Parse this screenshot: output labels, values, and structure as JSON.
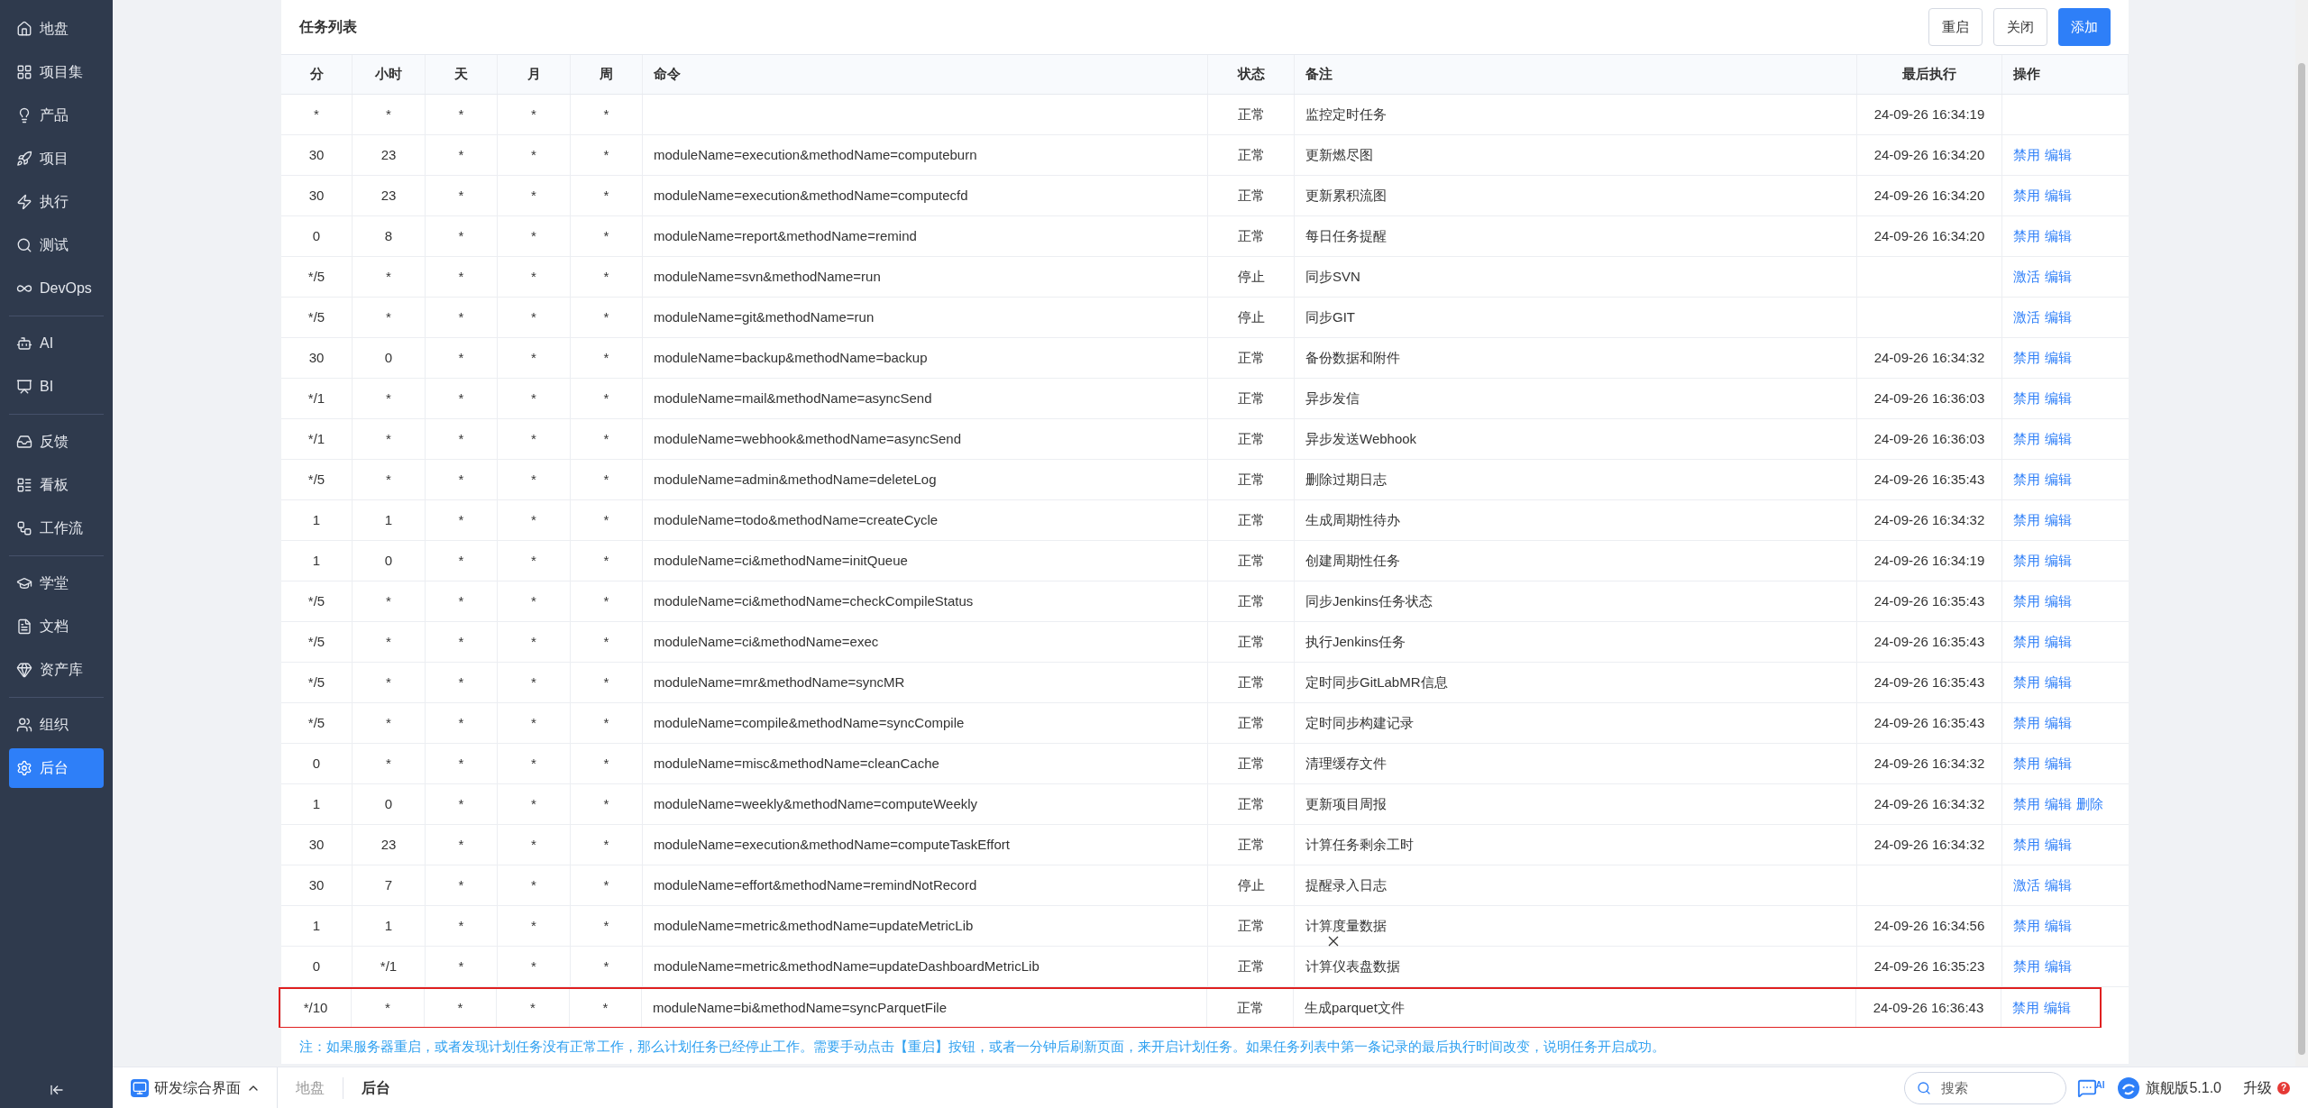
{
  "sidebar": {
    "groups": [
      [
        {
          "label": "地盘",
          "selected": false
        },
        {
          "label": "项目集",
          "selected": false
        },
        {
          "label": "产品",
          "selected": false
        },
        {
          "label": "项目",
          "selected": false
        },
        {
          "label": "执行",
          "selected": false
        },
        {
          "label": "测试",
          "selected": false
        },
        {
          "label": "DevOps",
          "selected": false
        }
      ],
      [
        {
          "label": "AI",
          "selected": false
        },
        {
          "label": "BI",
          "selected": false
        }
      ],
      [
        {
          "label": "反馈",
          "selected": false
        },
        {
          "label": "看板",
          "selected": false
        },
        {
          "label": "工作流",
          "selected": false
        }
      ],
      [
        {
          "label": "学堂",
          "selected": false
        },
        {
          "label": "文档",
          "selected": false
        },
        {
          "label": "资产库",
          "selected": false
        }
      ],
      [
        {
          "label": "组织",
          "selected": false
        },
        {
          "label": "后台",
          "selected": true
        }
      ]
    ]
  },
  "panel": {
    "title": "任务列表",
    "buttons": [
      {
        "label": "重启",
        "primary": false
      },
      {
        "label": "关闭",
        "primary": false
      },
      {
        "label": "添加",
        "primary": true
      }
    ]
  },
  "table": {
    "columns": [
      "分",
      "小时",
      "天",
      "月",
      "周",
      "命令",
      "状态",
      "备注",
      "最后执行",
      "操作"
    ],
    "rows": [
      {
        "cells": [
          "*",
          "*",
          "*",
          "*",
          "*",
          "",
          "正常",
          "监控定时任务",
          "24-09-26 16:34:19"
        ],
        "actions": [],
        "highlighted": false
      },
      {
        "cells": [
          "30",
          "23",
          "*",
          "*",
          "*",
          "moduleName=execution&methodName=computeburn",
          "正常",
          "更新燃尽图",
          "24-09-26 16:34:20"
        ],
        "actions": [
          "禁用",
          "编辑"
        ],
        "highlighted": false
      },
      {
        "cells": [
          "30",
          "23",
          "*",
          "*",
          "*",
          "moduleName=execution&methodName=computecfd",
          "正常",
          "更新累积流图",
          "24-09-26 16:34:20"
        ],
        "actions": [
          "禁用",
          "编辑"
        ],
        "highlighted": false
      },
      {
        "cells": [
          "0",
          "8",
          "*",
          "*",
          "*",
          "moduleName=report&methodName=remind",
          "正常",
          "每日任务提醒",
          "24-09-26 16:34:20"
        ],
        "actions": [
          "禁用",
          "编辑"
        ],
        "highlighted": false
      },
      {
        "cells": [
          "*/5",
          "*",
          "*",
          "*",
          "*",
          "moduleName=svn&methodName=run",
          "停止",
          "同步SVN",
          ""
        ],
        "actions": [
          "激活",
          "编辑"
        ],
        "highlighted": false
      },
      {
        "cells": [
          "*/5",
          "*",
          "*",
          "*",
          "*",
          "moduleName=git&methodName=run",
          "停止",
          "同步GIT",
          ""
        ],
        "actions": [
          "激活",
          "编辑"
        ],
        "highlighted": false
      },
      {
        "cells": [
          "30",
          "0",
          "*",
          "*",
          "*",
          "moduleName=backup&methodName=backup",
          "正常",
          "备份数据和附件",
          "24-09-26 16:34:32"
        ],
        "actions": [
          "禁用",
          "编辑"
        ],
        "highlighted": false
      },
      {
        "cells": [
          "*/1",
          "*",
          "*",
          "*",
          "*",
          "moduleName=mail&methodName=asyncSend",
          "正常",
          "异步发信",
          "24-09-26 16:36:03"
        ],
        "actions": [
          "禁用",
          "编辑"
        ],
        "highlighted": false
      },
      {
        "cells": [
          "*/1",
          "*",
          "*",
          "*",
          "*",
          "moduleName=webhook&methodName=asyncSend",
          "正常",
          "异步发送Webhook",
          "24-09-26 16:36:03"
        ],
        "actions": [
          "禁用",
          "编辑"
        ],
        "highlighted": false
      },
      {
        "cells": [
          "*/5",
          "*",
          "*",
          "*",
          "*",
          "moduleName=admin&methodName=deleteLog",
          "正常",
          "删除过期日志",
          "24-09-26 16:35:43"
        ],
        "actions": [
          "禁用",
          "编辑"
        ],
        "highlighted": false
      },
      {
        "cells": [
          "1",
          "1",
          "*",
          "*",
          "*",
          "moduleName=todo&methodName=createCycle",
          "正常",
          "生成周期性待办",
          "24-09-26 16:34:32"
        ],
        "actions": [
          "禁用",
          "编辑"
        ],
        "highlighted": false
      },
      {
        "cells": [
          "1",
          "0",
          "*",
          "*",
          "*",
          "moduleName=ci&methodName=initQueue",
          "正常",
          "创建周期性任务",
          "24-09-26 16:34:19"
        ],
        "actions": [
          "禁用",
          "编辑"
        ],
        "highlighted": false
      },
      {
        "cells": [
          "*/5",
          "*",
          "*",
          "*",
          "*",
          "moduleName=ci&methodName=checkCompileStatus",
          "正常",
          "同步Jenkins任务状态",
          "24-09-26 16:35:43"
        ],
        "actions": [
          "禁用",
          "编辑"
        ],
        "highlighted": false
      },
      {
        "cells": [
          "*/5",
          "*",
          "*",
          "*",
          "*",
          "moduleName=ci&methodName=exec",
          "正常",
          "执行Jenkins任务",
          "24-09-26 16:35:43"
        ],
        "actions": [
          "禁用",
          "编辑"
        ],
        "highlighted": false
      },
      {
        "cells": [
          "*/5",
          "*",
          "*",
          "*",
          "*",
          "moduleName=mr&methodName=syncMR",
          "正常",
          "定时同步GitLabMR信息",
          "24-09-26 16:35:43"
        ],
        "actions": [
          "禁用",
          "编辑"
        ],
        "highlighted": false
      },
      {
        "cells": [
          "*/5",
          "*",
          "*",
          "*",
          "*",
          "moduleName=compile&methodName=syncCompile",
          "正常",
          "定时同步构建记录",
          "24-09-26 16:35:43"
        ],
        "actions": [
          "禁用",
          "编辑"
        ],
        "highlighted": false
      },
      {
        "cells": [
          "0",
          "*",
          "*",
          "*",
          "*",
          "moduleName=misc&methodName=cleanCache",
          "正常",
          "清理缓存文件",
          "24-09-26 16:34:32"
        ],
        "actions": [
          "禁用",
          "编辑"
        ],
        "highlighted": false
      },
      {
        "cells": [
          "1",
          "0",
          "*",
          "*",
          "*",
          "moduleName=weekly&methodName=computeWeekly",
          "正常",
          "更新项目周报",
          "24-09-26 16:34:32"
        ],
        "actions": [
          "禁用",
          "编辑",
          "删除"
        ],
        "highlighted": false
      },
      {
        "cells": [
          "30",
          "23",
          "*",
          "*",
          "*",
          "moduleName=execution&methodName=computeTaskEffort",
          "正常",
          "计算任务剩余工时",
          "24-09-26 16:34:32"
        ],
        "actions": [
          "禁用",
          "编辑"
        ],
        "highlighted": false
      },
      {
        "cells": [
          "30",
          "7",
          "*",
          "*",
          "*",
          "moduleName=effort&methodName=remindNotRecord",
          "停止",
          "提醒录入日志",
          ""
        ],
        "actions": [
          "激活",
          "编辑"
        ],
        "highlighted": false
      },
      {
        "cells": [
          "1",
          "1",
          "*",
          "*",
          "*",
          "moduleName=metric&methodName=updateMetricLib",
          "正常",
          "计算度量数据",
          "24-09-26 16:34:56"
        ],
        "actions": [
          "禁用",
          "编辑"
        ],
        "highlighted": false
      },
      {
        "cells": [
          "0",
          "*/1",
          "*",
          "*",
          "*",
          "moduleName=metric&methodName=updateDashboardMetricLib",
          "正常",
          "计算仪表盘数据",
          "24-09-26 16:35:23"
        ],
        "actions": [
          "禁用",
          "编辑"
        ],
        "highlighted": false
      },
      {
        "cells": [
          "*/10",
          "*",
          "*",
          "*",
          "*",
          "moduleName=bi&methodName=syncParquetFile",
          "正常",
          "生成parquet文件",
          "24-09-26 16:36:43"
        ],
        "actions": [
          "禁用",
          "编辑"
        ],
        "highlighted": true
      }
    ]
  },
  "note": "注：如果服务器重启，或者发现计划任务没有正常工作，那么计划任务已经停止工作。需要手动点击【重启】按钮，或者一分钟后刷新页面，来开启计划任务。如果任务列表中第一条记录的最后执行时间改变，说明任务开启成功。",
  "bottom_bar": {
    "app_switcher": "研发综合界面",
    "breadcrumbs": [
      {
        "label": "地盘",
        "selected": false
      },
      {
        "label": "后台",
        "selected": true
      }
    ],
    "search": {
      "placeholder": "搜索"
    },
    "ai_badge": "AI",
    "edition": "旗舰版5.1.0",
    "upgrade": "升级",
    "upgrade_badge": "?"
  }
}
